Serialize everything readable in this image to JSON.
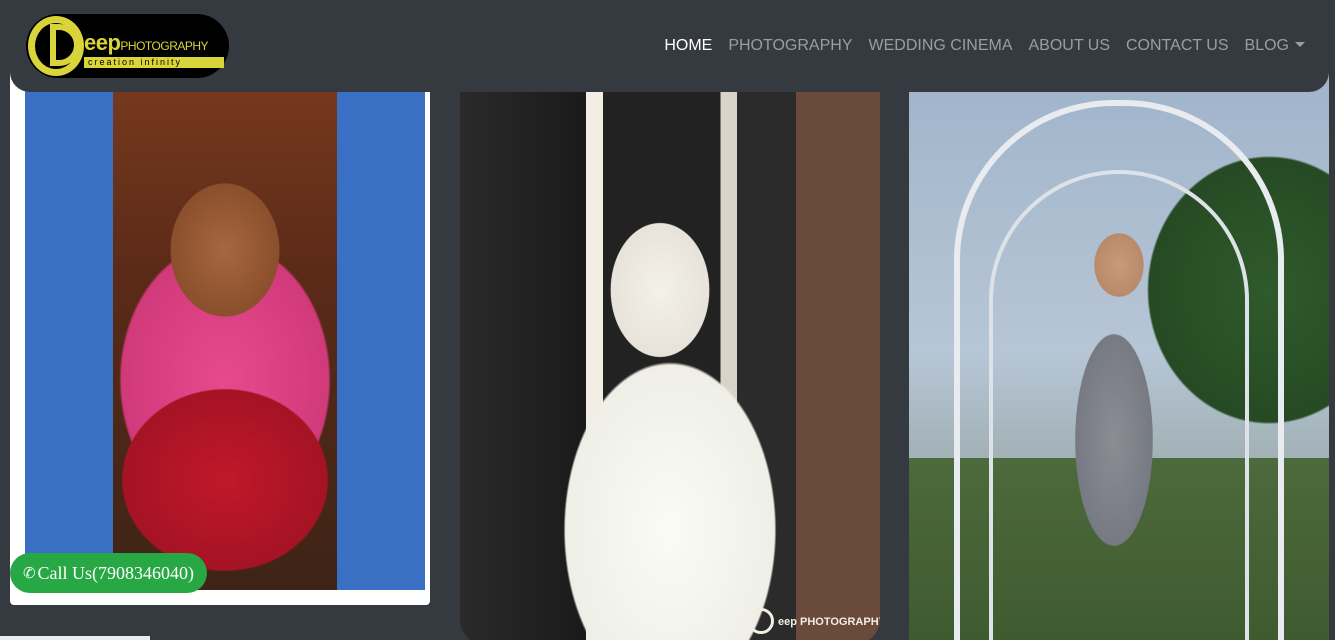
{
  "brand": {
    "logo_name": "eep",
    "logo_suffix": "PHOTOGRAPHY",
    "logo_tagline": "creation infinity"
  },
  "nav": {
    "items": [
      {
        "label": "HOME",
        "active": true
      },
      {
        "label": "PHOTOGRAPHY",
        "active": false
      },
      {
        "label": "WEDDING CINEMA",
        "active": false
      },
      {
        "label": "ABOUT US",
        "active": false
      },
      {
        "label": "CONTACT US",
        "active": false
      },
      {
        "label": "BLOG",
        "active": false,
        "dropdown": true
      }
    ]
  },
  "gallery": {
    "watermark": "eep PHOTOGRAPHY"
  },
  "call": {
    "label": "Call Us(7908346040)",
    "icon": "phone-icon"
  },
  "colors": {
    "navbar_bg": "#343a40",
    "accent_logo": "#d8d43a",
    "call_button": "#28a745"
  }
}
